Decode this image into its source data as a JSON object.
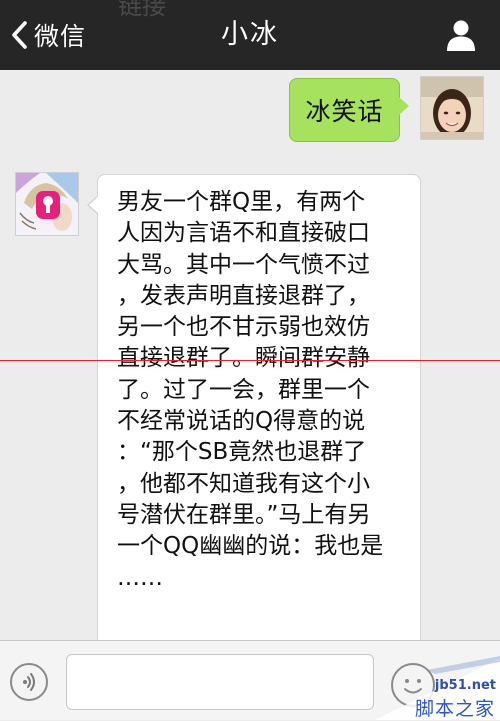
{
  "header": {
    "back_label": "微信",
    "title": "小冰",
    "ghost_text": "链接"
  },
  "chat": {
    "outgoing": {
      "text": "冰笑话"
    },
    "incoming": {
      "lines": [
        "男友一个群Q里，有两个",
        "人因为言语不和直接破口",
        "大骂。其中一个气愤不过",
        "，发表声明直接退群了，",
        "另一个也不甘示弱也效仿",
        "直接退群了。瞬间群安静",
        "了。过了一会，群里一个",
        "不经常说话的Q得意的说",
        "：“那个SB竟然也退群了",
        "，他都不知道我有这个小",
        "号潜伏在群里。”马上有另",
        "一个QQ幽幽的说：我也是",
        "……"
      ]
    }
  },
  "input": {
    "value": ""
  },
  "watermark": {
    "domain": "jb51.net",
    "name": "脚本之家"
  },
  "colors": {
    "header_bg": "#262626",
    "chat_bg": "#ececec",
    "outgoing_bubble": "#a7e25f",
    "incoming_bubble": "#ffffff",
    "red_line": "#e0242b"
  }
}
